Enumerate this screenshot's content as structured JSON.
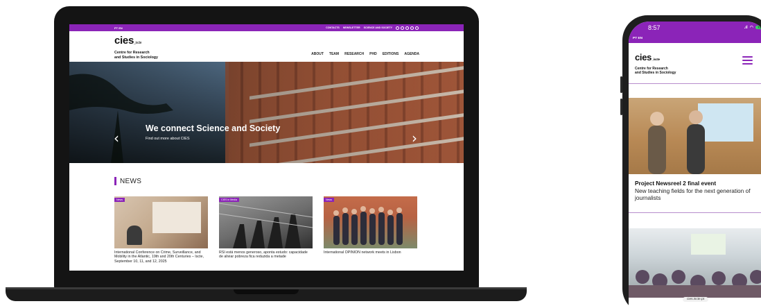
{
  "desktop": {
    "topbar": {
      "lang": "PT EN",
      "links": [
        "CONTACTS",
        "NEWSLETTER",
        "SCIENCE AND SOCIETY"
      ],
      "social_icons": [
        "facebook-icon",
        "twitter-icon",
        "youtube-icon",
        "instagram-icon",
        "linkedin-icon"
      ]
    },
    "logo": {
      "word": "cies",
      "suffix": "_iscte",
      "tagline_1": "Centre for Research",
      "tagline_2": "and Studies in Sociology"
    },
    "nav": [
      "ABOUT",
      "TEAM",
      "RESEARCH",
      "PHD",
      "EDITIONS",
      "AGENDA"
    ],
    "hero": {
      "title": "We connect Science and Society",
      "subtitle": "Find out more about CIES",
      "prev_icon": "chevron-left-icon",
      "next_icon": "chevron-right-icon"
    },
    "news": {
      "heading": "NEWS",
      "cards": [
        {
          "tag": "News",
          "text": "International Conference on Crime, Surveillance, and Mobility in the Atlantic, 19th and 20th Centuries – Iscte, September 10, 11, and 12, 2025"
        },
        {
          "tag": "CIES in Media",
          "text": "RSI está menos generoso, aponta estudo: capacidade de aliviar pobreza fica reduzida a metade"
        },
        {
          "tag": "News",
          "text": "International OPINION network meets in Lisbon"
        }
      ]
    }
  },
  "mobile": {
    "status": {
      "time": "8:57",
      "signal": ".ıl",
      "battery": "73"
    },
    "lang": "PT EN",
    "logo": {
      "word": "cies",
      "suffix": "_iscte",
      "tagline_1": "Centre for Research",
      "tagline_2": "and Studies in Sociology"
    },
    "menu_icon": "hamburger-menu-icon",
    "news_title": "Project Newsreel 2 final event",
    "news_subtitle": "New teaching fields for the next generation of journalists",
    "url": "cies.iscte.pt"
  },
  "colors": {
    "brand": "#8b24b8",
    "device": "#141414"
  }
}
